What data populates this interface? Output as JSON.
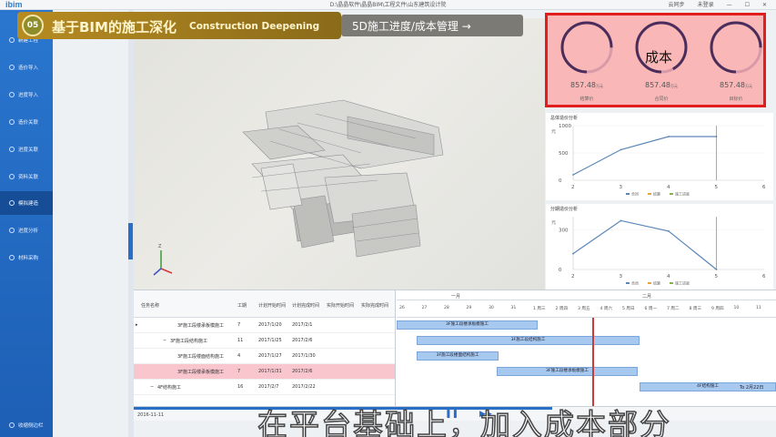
{
  "titlebar": {
    "logo": "ibim",
    "window_title": "D:\\晶晶软件\\晶晶BIM\\工程文件\\山东建筑设计院",
    "sync_label": "云同步",
    "user_label": "未登录"
  },
  "sidebar": {
    "items": [
      {
        "label": "新建工程"
      },
      {
        "label": "造价导入"
      },
      {
        "label": "进度导入"
      },
      {
        "label": "造价关联"
      },
      {
        "label": "进度关联"
      },
      {
        "label": "资料关联"
      },
      {
        "label": "模拟建造"
      },
      {
        "label": "进度分析"
      },
      {
        "label": "材料采购"
      }
    ],
    "collapse_label": "收缩侧边栏"
  },
  "banner": {
    "number": "05",
    "title_cn": "基于BIM的施工深化",
    "title_en": "Construction Deepening",
    "section_title": "5D施工进度/成本管理 →"
  },
  "gauges": [
    {
      "value": "857.48",
      "unit": "万元",
      "label": "结算价",
      "fill": 0.75,
      "color": "#4a2d5a"
    },
    {
      "value": "857.48",
      "unit": "万元",
      "label": "合同价",
      "fill": 0.92,
      "color": "#4a2d5a"
    },
    {
      "value": "857.48",
      "unit": "万元",
      "label": "目标价",
      "fill": 0.75,
      "color": "#4a2d5a"
    }
  ],
  "overlay_label": "成本",
  "charts": [
    {
      "title": "总体造价分析",
      "y_unit": "元",
      "chart_data": {
        "type": "line",
        "x": [
          2,
          3,
          4,
          5,
          6
        ],
        "series": [
          {
            "values": [
              100,
              560,
              800,
              800,
              null
            ]
          }
        ],
        "ylim": [
          0,
          1000
        ],
        "yticks": [
          "1000",
          "500",
          "0"
        ],
        "xticks": [
          "2",
          "3",
          "4",
          "5",
          "6"
        ],
        "legend": [
          "合同",
          "结算",
          "施工进度"
        ]
      }
    },
    {
      "title": "分期造价分析",
      "y_unit": "元",
      "chart_data": {
        "type": "line",
        "x": [
          2,
          3,
          4,
          5,
          6
        ],
        "series": [
          {
            "values": [
              120,
              370,
              290,
              0,
              null
            ]
          }
        ],
        "ylim": [
          0,
          400
        ],
        "yticks": [
          "300",
          "0"
        ],
        "xticks": [
          "2",
          "3",
          "4",
          "5",
          "6"
        ],
        "legend": [
          "合同",
          "结算",
          "施工进度"
        ]
      }
    }
  ],
  "gantt": {
    "headers": [
      "任务名称",
      "工期",
      "计划开始时间",
      "计划完成时间",
      "实际开始时间",
      "实际完成时间"
    ],
    "rows": [
      {
        "name": "3F施工段楼承板模施工",
        "duration": "7",
        "start": "2017/1/20",
        "end": "2017/2/1",
        "highlight": false
      },
      {
        "name": "3F施工段结构施工",
        "duration": "11",
        "start": "2017/1/25",
        "end": "2017/2/6",
        "highlight": false
      },
      {
        "name": "3F施工段楼面结构施工",
        "duration": "4",
        "start": "2017/1/27",
        "end": "2017/1/30",
        "highlight": false
      },
      {
        "name": "3F施工段楼承板模施工",
        "duration": "7",
        "start": "2017/1/31",
        "end": "2017/2/6",
        "highlight": true
      },
      {
        "name": "4F结构施工",
        "duration": "16",
        "start": "2017/2/7",
        "end": "2017/2/22",
        "highlight": false
      }
    ],
    "months": [
      "一月",
      "二月"
    ],
    "days": [
      "26",
      "27",
      "28",
      "29",
      "30",
      "31",
      "1 周三",
      "2 周四",
      "3 周五",
      "4 周六",
      "5 周日",
      "6 周一",
      "7 周二",
      "8 周三",
      "9 周四",
      "10",
      "11"
    ],
    "bars": [
      {
        "label": "3F施工段楼承板模施工",
        "start": 0,
        "width": 155
      },
      {
        "label": "3F施工段结构施工",
        "start": 22,
        "width": 245
      },
      {
        "label": "3F施工段楼面结构施工",
        "start": 22,
        "width": 90
      },
      {
        "label": "3F施工段楼承板模施工",
        "start": 110,
        "width": 155
      },
      {
        "label": "4F结构施工",
        "start": 267,
        "width": 150,
        "trailing": "To 2月22日"
      }
    ],
    "status_date": "2016-11-11"
  },
  "caption": "在平台基础上，加入成本部分"
}
